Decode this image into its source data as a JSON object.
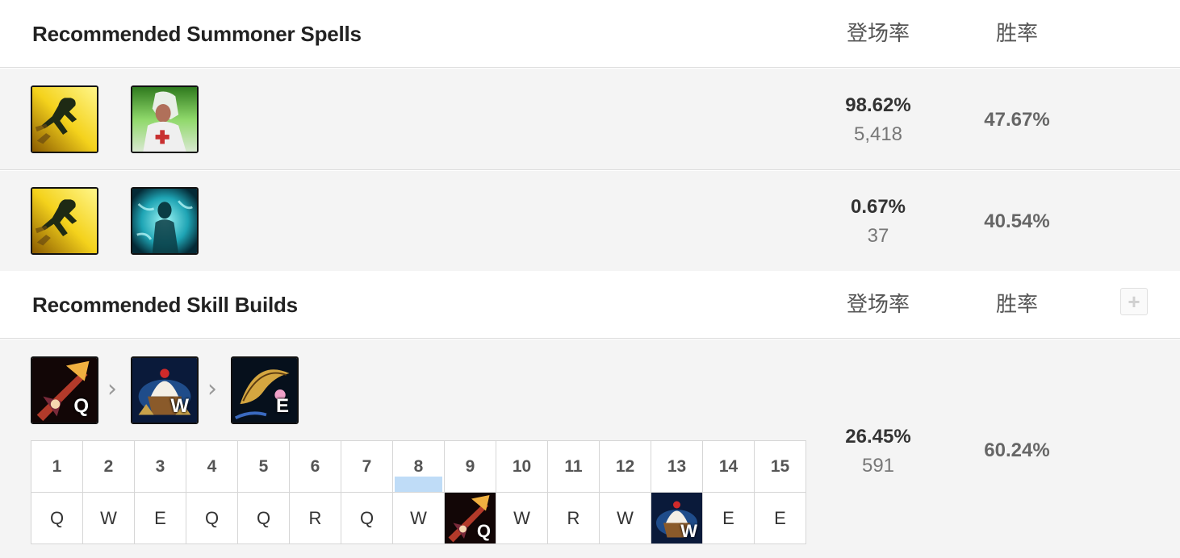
{
  "summoner": {
    "title": "Recommended Summoner Spells",
    "col_pick": "登场率",
    "col_win": "胜率",
    "rows": [
      {
        "spell1": "flash-spell-icon",
        "spell2": "heal-spell-icon",
        "pick_pct": "98.62%",
        "pick_count": "5,418",
        "win_pct": "47.67%"
      },
      {
        "spell1": "flash-spell-icon",
        "spell2": "ghost-spell-icon",
        "pick_pct": "0.67%",
        "pick_count": "37",
        "win_pct": "40.54%"
      }
    ]
  },
  "skills": {
    "title": "Recommended Skill Builds",
    "col_pick": "登场率",
    "col_win": "胜率",
    "plus_label": "+",
    "order_keys": [
      "Q",
      "W",
      "E"
    ],
    "order_icons": [
      "q-skill-icon",
      "w-skill-icon",
      "e-skill-icon"
    ],
    "chevron": "›",
    "levels": [
      "1",
      "2",
      "3",
      "4",
      "5",
      "6",
      "7",
      "8",
      "9",
      "10",
      "11",
      "12",
      "13",
      "14",
      "15"
    ],
    "sequence": [
      "Q",
      "W",
      "E",
      "Q",
      "Q",
      "R",
      "Q",
      "W",
      "Q",
      "W",
      "R",
      "W",
      "W",
      "E",
      "E"
    ],
    "pick_pct": "26.45%",
    "pick_count": "591",
    "win_pct": "60.24%"
  }
}
